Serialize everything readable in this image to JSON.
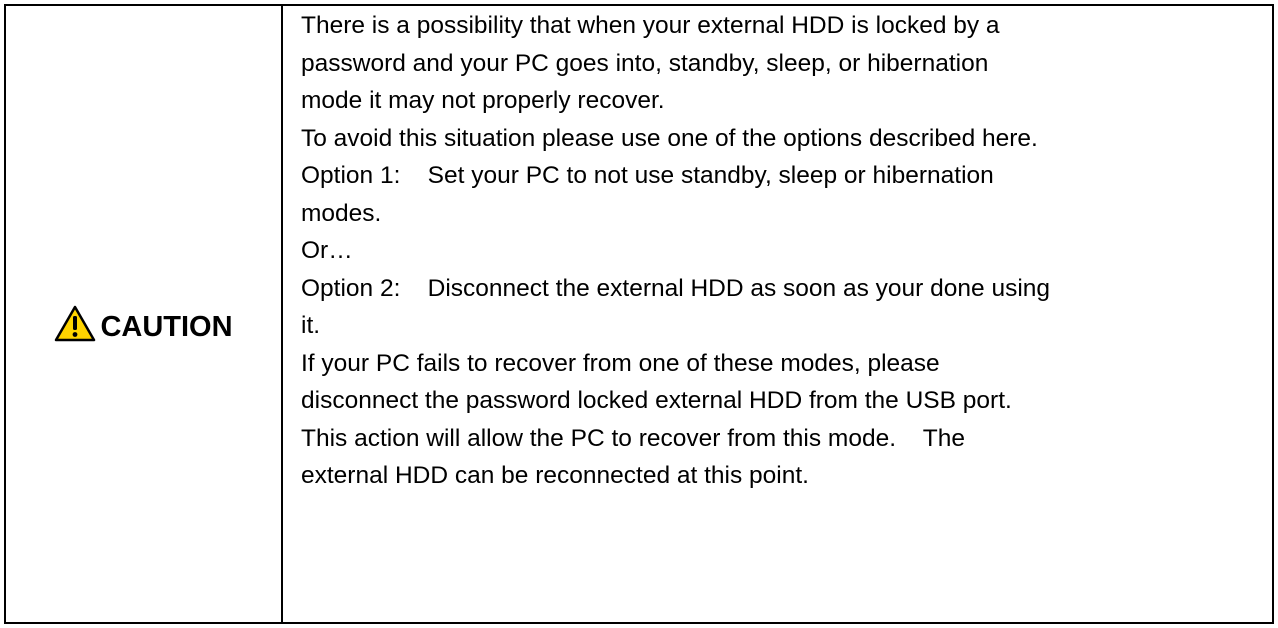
{
  "caution": {
    "icon": "warning-triangle-icon",
    "icon_color": "#ffd400",
    "label": "CAUTION",
    "lines": [
      "There is a possibility that when your external HDD is locked by a",
      "password and your PC goes into, standby, sleep, or hibernation",
      "mode it may not properly recover.",
      "To avoid this situation please use one of the options described here.",
      "Option 1:    Set your PC to not use standby, sleep or hibernation",
      "modes.",
      "Or…",
      "Option 2:    Disconnect the external HDD as soon as your done using",
      "it.",
      "If your PC fails to recover from one of these modes, please",
      "disconnect the password locked external HDD from the USB port.",
      "This action will allow the PC to recover from this mode.    The",
      "external HDD can be reconnected at this point."
    ]
  }
}
